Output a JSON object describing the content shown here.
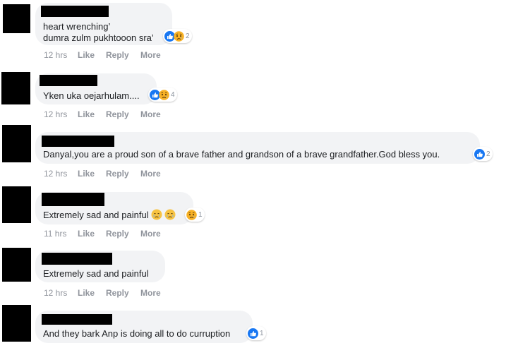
{
  "comments": [
    {
      "text_lines": [
        "heart wrenching’",
        "dumra zulm pukhtooon sra’"
      ],
      "reactions": [
        "like-icon",
        "sad-icon"
      ],
      "reaction_count": "2",
      "time": "12 hrs",
      "like": "Like",
      "reply": "Reply",
      "more": "More"
    },
    {
      "text_lines": [
        "Yken uka oejarhulam...."
      ],
      "reactions": [
        "like-icon",
        "sad-icon"
      ],
      "reaction_count": "4",
      "time": "12 hrs",
      "like": "Like",
      "reply": "Reply",
      "more": "More"
    },
    {
      "text_lines": [
        "Danyal,you are a proud son of a brave father and grandson of a brave grandfather.God bless you."
      ],
      "reactions": [
        "like-icon"
      ],
      "reaction_count": "2",
      "time": "12 hrs",
      "like": "Like",
      "reply": "Reply",
      "more": "More"
    },
    {
      "text_lines": [
        "Extremely sad and painful"
      ],
      "inline_emoji": [
        "crying-face-icon",
        "crying-face-icon"
      ],
      "reactions": [
        "sad-icon"
      ],
      "reaction_count": "1",
      "time": "11 hrs",
      "like": "Like",
      "reply": "Reply",
      "more": "More"
    },
    {
      "text_lines": [
        "Extremely sad and painful"
      ],
      "reactions": [],
      "reaction_count": "",
      "time": "12 hrs",
      "like": "Like",
      "reply": "Reply",
      "more": "More"
    },
    {
      "text_lines": [
        "And they bark Anp is doing all to do curruption"
      ],
      "reactions": [
        "like-icon"
      ],
      "reaction_count": "1",
      "time": "",
      "like": "",
      "reply": "",
      "more": ""
    }
  ],
  "colors": {
    "bubble": "#f2f3f5",
    "like_blue": "#1877f2",
    "sad_yellow": "#f7b125",
    "meta_grey": "#90949c",
    "redaction": "#000000"
  }
}
